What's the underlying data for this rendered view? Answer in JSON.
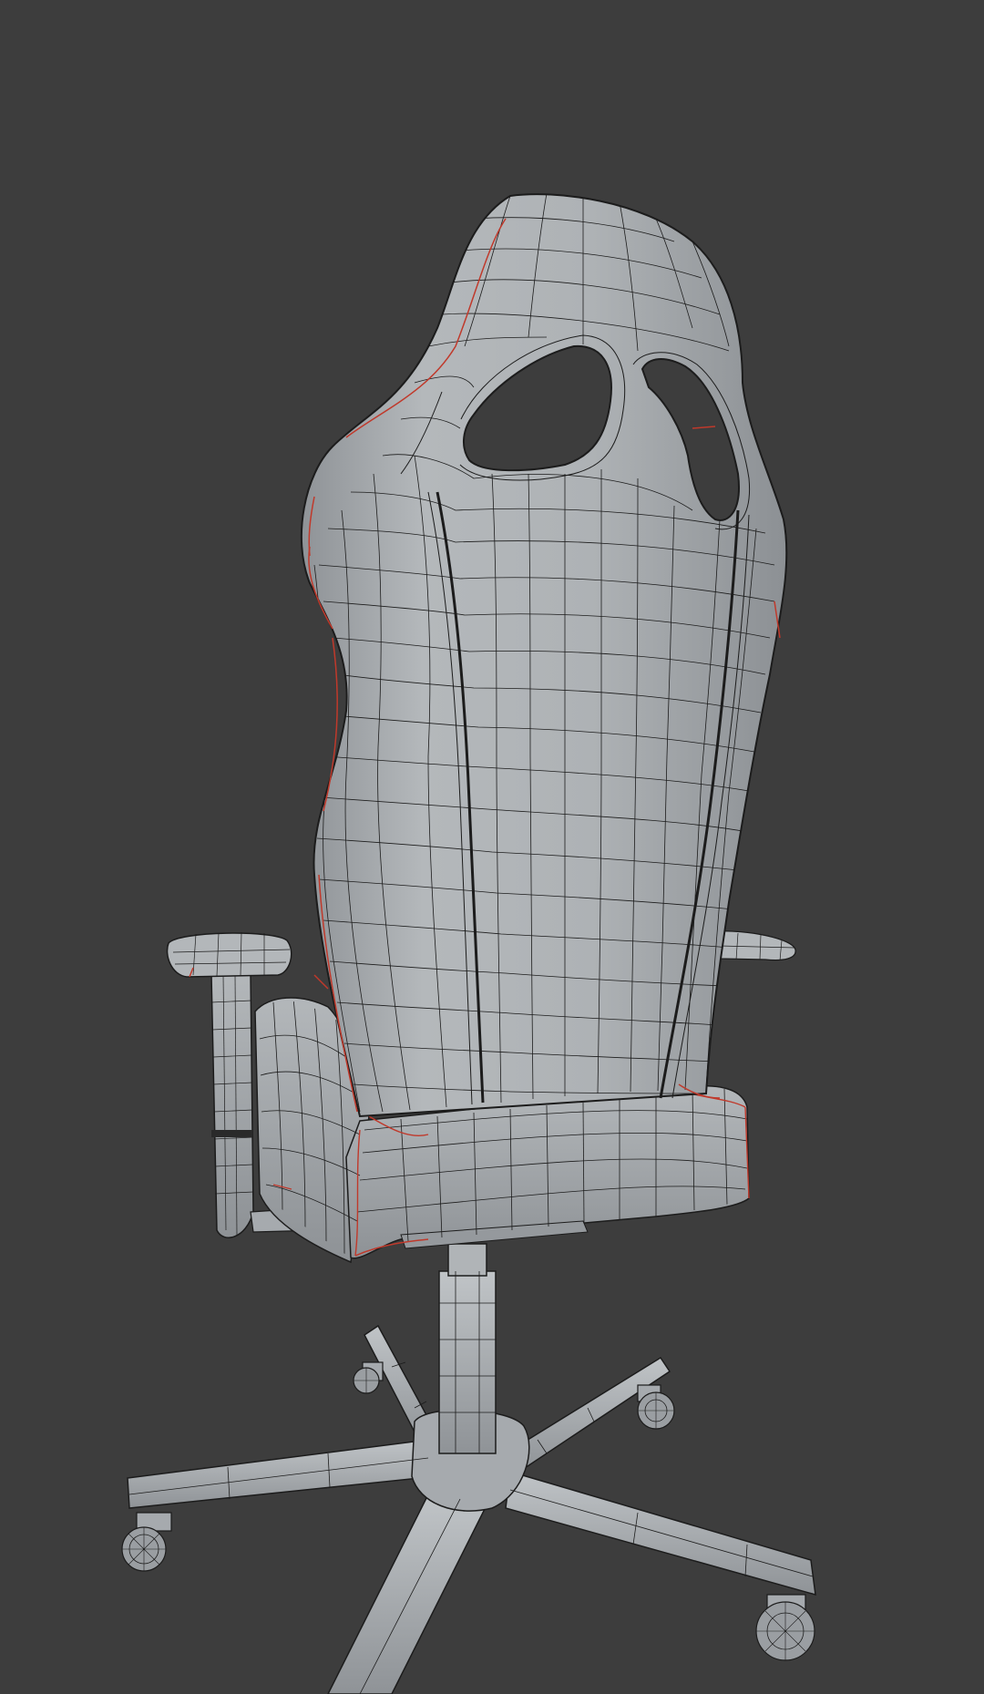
{
  "viewport": {
    "background_color": "#3d3d3d"
  },
  "model": {
    "subject": "gaming-chair",
    "surface_color": "#a9adb1",
    "wire_color": "#1c1c1c",
    "crease_color": "#c0392b"
  }
}
